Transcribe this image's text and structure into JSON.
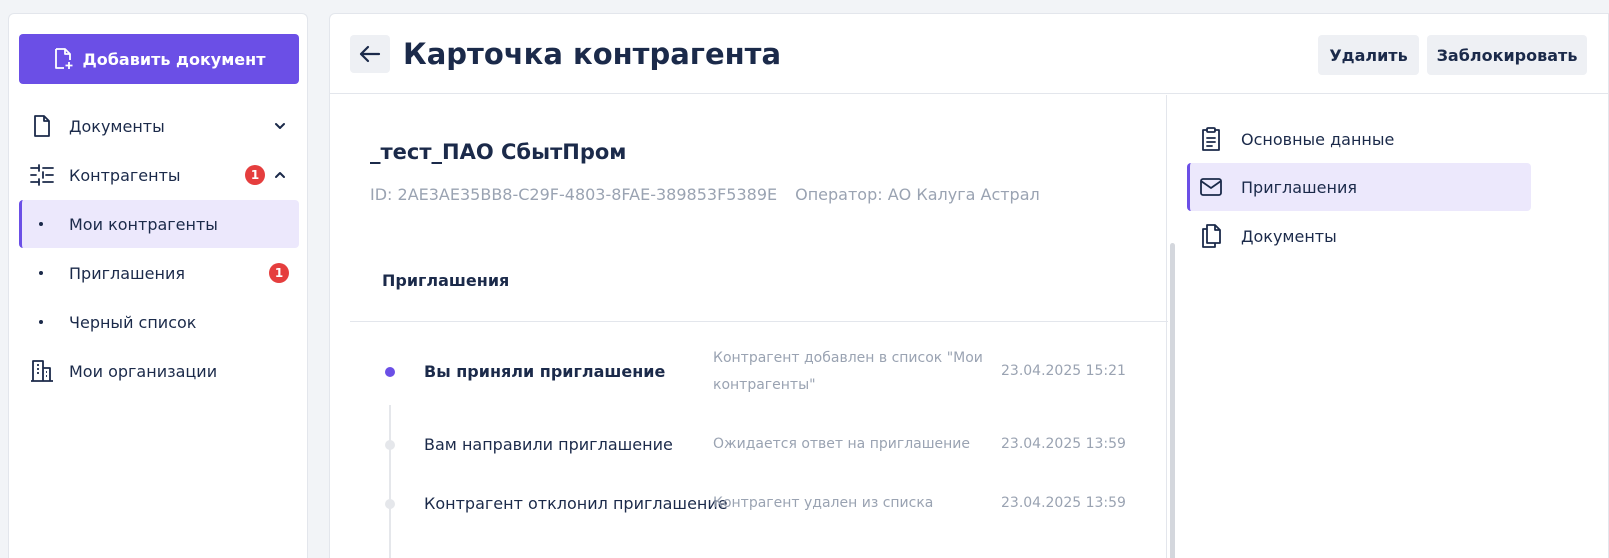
{
  "sidebar": {
    "add_button": "Добавить документ",
    "items": [
      {
        "label": "Документы",
        "icon": "file-icon",
        "expanded": false
      },
      {
        "label": "Контрагенты",
        "icon": "counterparties-icon",
        "badge": "1",
        "expanded": true
      },
      {
        "label": "Мои организации",
        "icon": "building-icon"
      }
    ],
    "sub_items": [
      {
        "label": "Мои контрагенты",
        "active": true
      },
      {
        "label": "Приглашения",
        "badge": "1"
      },
      {
        "label": "Черный список"
      }
    ]
  },
  "header": {
    "title": "Карточка контрагента",
    "delete_label": "Удалить",
    "block_label": "Заблокировать"
  },
  "organization": {
    "name": "_тест_ПАО СбытПром",
    "id": "ID: 2AE3AE35BB8-C29F-4803-8FAE-389853F5389E",
    "operator": "Оператор: АО Калуга Астрал"
  },
  "invitations": {
    "section_title": "Приглашения",
    "events": [
      {
        "title": "Вы приняли приглашение",
        "description": "Контрагент добавлен в список \"Мои контрагенты\"",
        "date": "23.04.2025 15:21",
        "active": true
      },
      {
        "title": "Вам направили приглашение",
        "description": "Ожидается ответ на приглашение",
        "date": "23.04.2025 13:59",
        "active": false
      },
      {
        "title": "Контрагент отклонил приглашение",
        "description": "Контрагент удален из списка",
        "date": "23.04.2025 13:59",
        "active": false
      }
    ]
  },
  "right_nav": {
    "items": [
      {
        "label": "Основные данные",
        "icon": "clipboard-icon"
      },
      {
        "label": "Приглашения",
        "icon": "mail-icon",
        "active": true
      },
      {
        "label": "Документы",
        "icon": "documents-icon"
      }
    ]
  },
  "colors": {
    "accent": "#6b4fe6",
    "active_bg": "#ece8fc",
    "badge": "#e53e3e",
    "text": "#1b2a4a",
    "muted": "#9aa3b2"
  }
}
